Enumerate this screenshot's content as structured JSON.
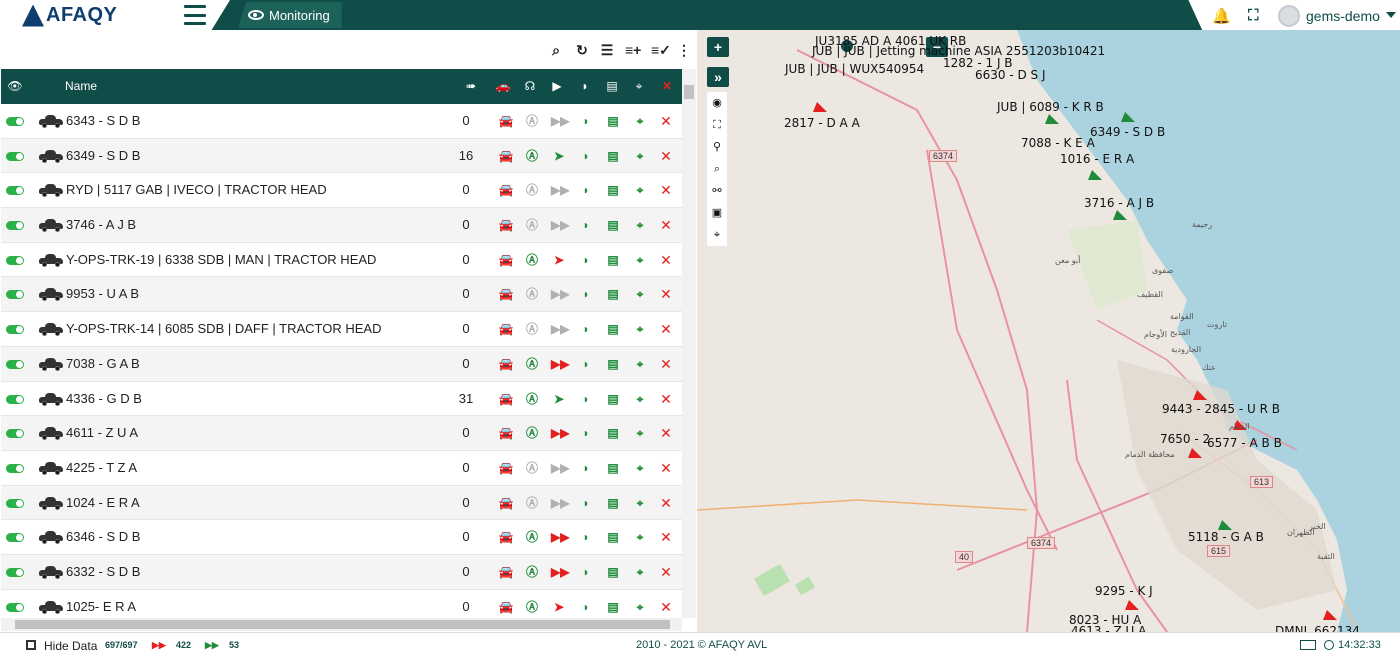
{
  "brand": {
    "logo_text": "AFAQY"
  },
  "tabs": {
    "monitoring": "Monitoring"
  },
  "user": {
    "name": "gems-demo"
  },
  "grid": {
    "header_name": "Name",
    "rows": [
      {
        "name": "6343 - S D B",
        "speed": "0",
        "status": "gray"
      },
      {
        "name": "6349 - S D B",
        "speed": "16",
        "status": "green"
      },
      {
        "name": "RYD | 5117 GAB | IVECO | TRACTOR HEAD",
        "speed": "0",
        "status": "gray"
      },
      {
        "name": "3746 - A J B",
        "speed": "0",
        "status": "gray"
      },
      {
        "name": "Y-OPS-TRK-19 | 6338 SDB | MAN | TRACTOR HEAD",
        "speed": "0",
        "status": "red-green"
      },
      {
        "name": "9953 - U A B",
        "speed": "0",
        "status": "gray"
      },
      {
        "name": "Y-OPS-TRK-14 | 6085 SDB | DAFF | TRACTOR HEAD",
        "speed": "0",
        "status": "gray"
      },
      {
        "name": "7038 - G A B",
        "speed": "0",
        "status": "red"
      },
      {
        "name": "4336 - G D B",
        "speed": "31",
        "status": "green"
      },
      {
        "name": "4611 - Z U A",
        "speed": "0",
        "status": "red"
      },
      {
        "name": "4225 - T Z A",
        "speed": "0",
        "status": "gray"
      },
      {
        "name": "1024 - E R A",
        "speed": "0",
        "status": "gray"
      },
      {
        "name": "6346 - S D B",
        "speed": "0",
        "status": "red"
      },
      {
        "name": "6332 - S D B",
        "speed": "0",
        "status": "red"
      },
      {
        "name": "1025- E R A",
        "speed": "0",
        "status": "red-green"
      }
    ]
  },
  "map": {
    "vehicle_labels": [
      "JU3185 AD A 4061 UK RB",
      "JUB | JUB | Jetting machine ASIA 2551203b10421",
      "1282 - 1 J B",
      "JUB | JUB | WUX540954",
      "6630 - D S J",
      "2817 - D A A",
      "JUB | 6089 - K R B",
      "6349 - S D B",
      "7088 - K E A",
      "1016 - E R A",
      "3716 - A J B",
      "9443 - 2845 - U R B",
      "7650 - 2",
      "6577 - A B B",
      "5118 - G A B",
      "9295 - K J",
      "8023 - HU A",
      "4613 - Z U A",
      "DMNL 662134"
    ],
    "road_labels": [
      "6374",
      "6374",
      "613",
      "615",
      "40"
    ],
    "place_labels": [
      "رحيمة",
      "صفوى",
      "القطيف",
      "القوامة",
      "القديح",
      "الأوجام",
      "الجارودية",
      "عنك",
      "الدمام",
      "محافظة الدمام",
      "الخبر",
      "الظهران",
      "الثقبة",
      "تاروت",
      "أبو معن"
    ],
    "controls": {
      "zoom_in": "+",
      "zoom_out": "−",
      "expand": "»"
    }
  },
  "footer": {
    "hide_data": "Hide Data",
    "total_count": "697/697",
    "stopped_count": "422",
    "moving_count": "53",
    "copyright": "2010 - 2021 © AFAQY AVL",
    "time": "14:32:33"
  },
  "colors": {
    "primary": "#114d48",
    "green": "#1e8c3a",
    "red": "#e32020",
    "gray": "#b0b0b0"
  }
}
